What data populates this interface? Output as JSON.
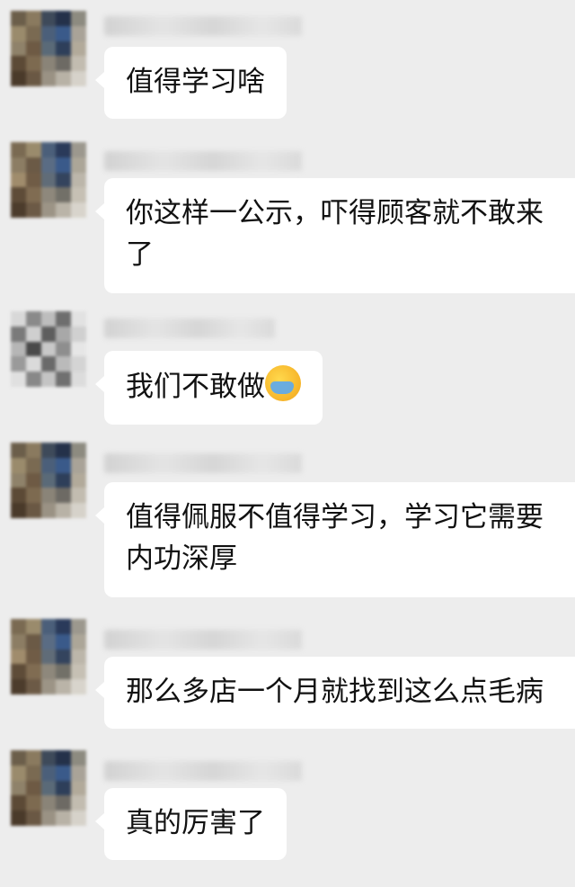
{
  "messages": [
    {
      "text": "值得学习啥"
    },
    {
      "text": "你这样一公示，吓得顾客就不敢来了"
    },
    {
      "text": "我们不敢做",
      "emoji": "face-palm-crying-emoji"
    },
    {
      "text": "值得佩服不值得学习，学习它需要内功深厚"
    },
    {
      "text": "那么多店一个月就找到这么点毛病"
    },
    {
      "text": "真的厉害了"
    }
  ]
}
